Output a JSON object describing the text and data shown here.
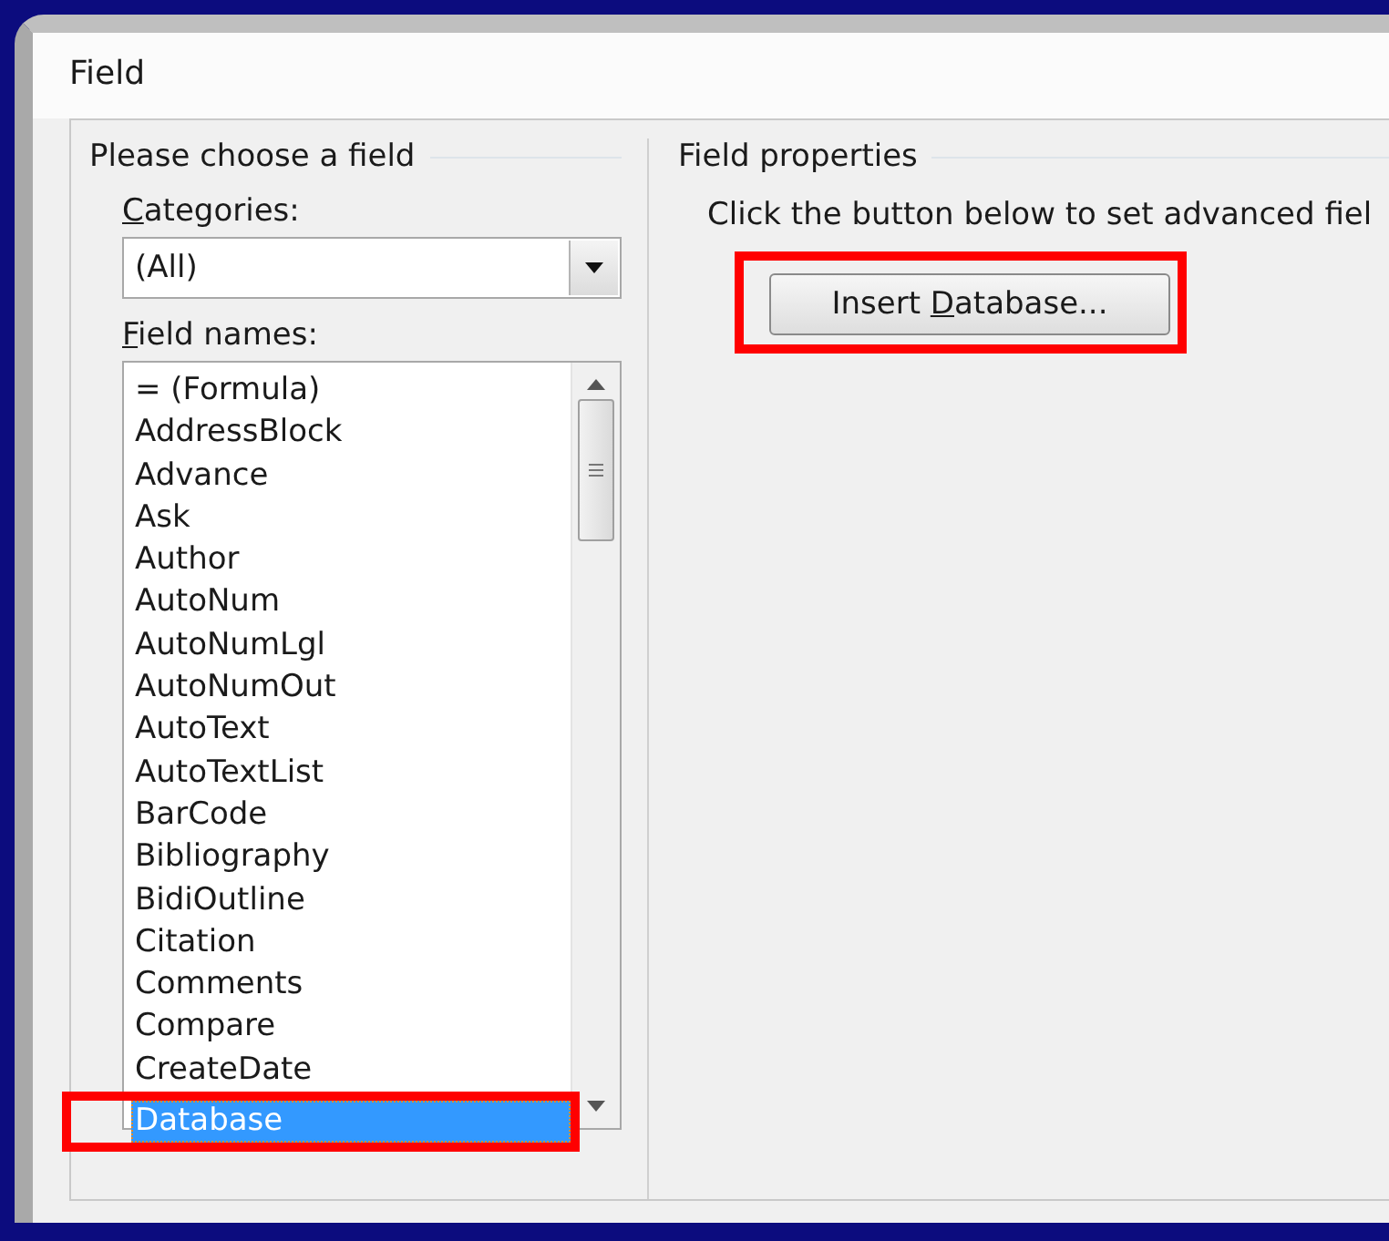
{
  "window": {
    "title": "Field"
  },
  "choose_group": {
    "title": "Please choose a field",
    "categories": {
      "label": {
        "key": "C",
        "rest": "ategories:"
      },
      "value": "(All)"
    },
    "field_names": {
      "label": {
        "key": "F",
        "rest": "ield names:"
      },
      "items": [
        {
          "name": "= (Formula)",
          "selected": false,
          "highlighted": false
        },
        {
          "name": "AddressBlock",
          "selected": false,
          "highlighted": false
        },
        {
          "name": "Advance",
          "selected": false,
          "highlighted": false
        },
        {
          "name": "Ask",
          "selected": false,
          "highlighted": false
        },
        {
          "name": "Author",
          "selected": false,
          "highlighted": false
        },
        {
          "name": "AutoNum",
          "selected": false,
          "highlighted": false
        },
        {
          "name": "AutoNumLgl",
          "selected": false,
          "highlighted": false
        },
        {
          "name": "AutoNumOut",
          "selected": false,
          "highlighted": false
        },
        {
          "name": "AutoText",
          "selected": false,
          "highlighted": false
        },
        {
          "name": "AutoTextList",
          "selected": false,
          "highlighted": false
        },
        {
          "name": "BarCode",
          "selected": false,
          "highlighted": false
        },
        {
          "name": "Bibliography",
          "selected": false,
          "highlighted": false
        },
        {
          "name": "BidiOutline",
          "selected": false,
          "highlighted": false
        },
        {
          "name": "Citation",
          "selected": false,
          "highlighted": false
        },
        {
          "name": "Comments",
          "selected": false,
          "highlighted": false
        },
        {
          "name": "Compare",
          "selected": false,
          "highlighted": false
        },
        {
          "name": "CreateDate",
          "selected": false,
          "highlighted": false
        },
        {
          "name": "Database",
          "selected": true,
          "highlighted": true
        }
      ]
    }
  },
  "properties_group": {
    "title": "Field properties",
    "hint": "Click the button below to set advanced fiel",
    "button": {
      "label": {
        "before": "Insert ",
        "key": "D",
        "rest": "atabase..."
      },
      "highlighted": true
    }
  }
}
